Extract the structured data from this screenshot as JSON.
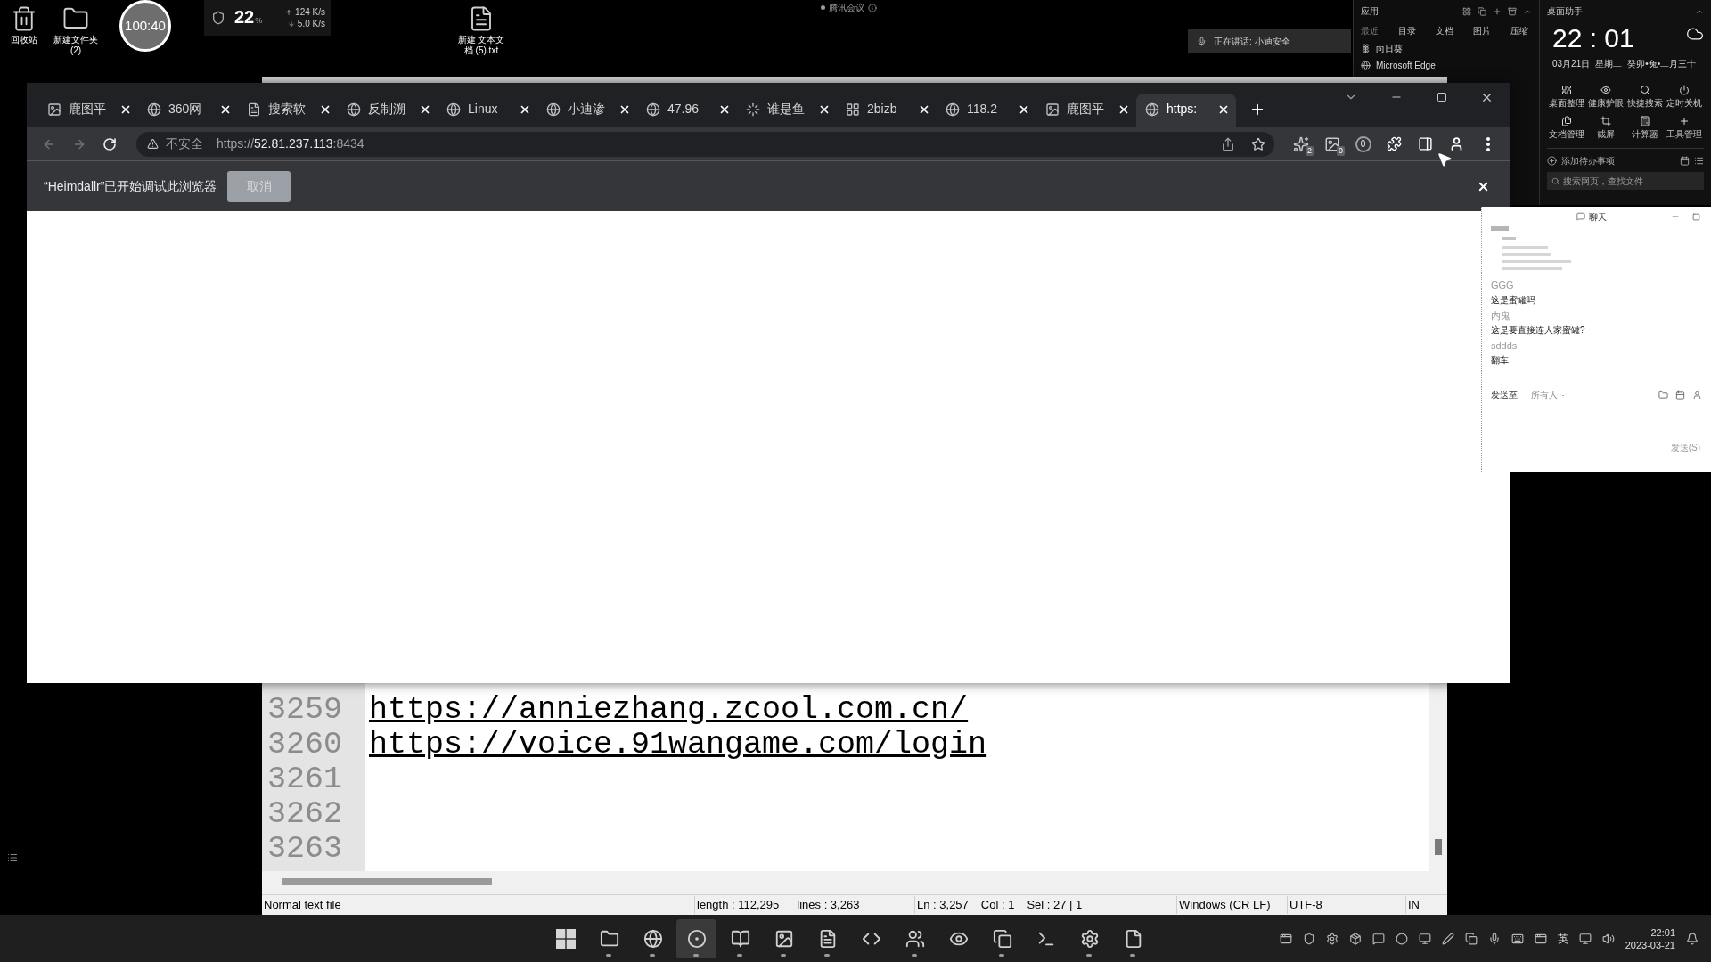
{
  "desktop_icons": [
    {
      "kind": "bin",
      "label": "回收站"
    },
    {
      "kind": "folder",
      "label": "新建文件夹 (2)"
    },
    {
      "kind": "text_file",
      "label": "新建 文本文档 (5).txt"
    }
  ],
  "timer_widget": {
    "text": "100:40"
  },
  "net_monitor": {
    "cpu": "22",
    "cpu_unit": "%",
    "upload": "124 K/s",
    "download": "5.0 K/s"
  },
  "meeting_indicator": {
    "label": "腾讯会议"
  },
  "speaking_bar": {
    "text": "正在讲话: 小迪安全"
  },
  "apps_panel": {
    "title": "应用",
    "tabs": [
      {
        "label": "最近",
        "selected": true
      },
      {
        "label": "目录",
        "selected": false
      },
      {
        "label": "文档",
        "selected": false
      },
      {
        "label": "图片",
        "selected": false
      },
      {
        "label": "压缩",
        "selected": false
      }
    ],
    "items": [
      {
        "kind": "sunflower",
        "label": "向日葵"
      },
      {
        "kind": "edge",
        "label": "Microsoft Edge"
      }
    ]
  },
  "desk_assistant": {
    "title": "桌面助手",
    "time": "22 : 01",
    "date": "03月21日",
    "weekday": "星期二",
    "lunar": "癸卯•兔•二月三十",
    "tools": [
      {
        "kind": "organize",
        "label": "桌面整理"
      },
      {
        "kind": "eye",
        "label": "健康护眼"
      },
      {
        "kind": "search",
        "label": "快捷搜索"
      },
      {
        "kind": "power",
        "label": "定时关机"
      },
      {
        "kind": "docs",
        "label": "文档管理"
      },
      {
        "kind": "crop",
        "label": "截屏"
      },
      {
        "kind": "calculator",
        "label": "计算器"
      },
      {
        "kind": "plus",
        "label": "工具管理"
      }
    ],
    "todo": "添加待办事项",
    "search": {
      "placeholder": "搜索网页，查找文件"
    }
  },
  "browser": {
    "tabs": [
      {
        "title": "鹿图平",
        "kind": "image",
        "selected": false
      },
      {
        "title": "360网",
        "kind": "globe",
        "selected": false
      },
      {
        "title": "搜索软",
        "kind": "doc",
        "selected": false
      },
      {
        "title": "反制溯",
        "kind": "globe",
        "selected": false
      },
      {
        "title": "Linux",
        "kind": "globe",
        "selected": false
      },
      {
        "title": "小迪渗",
        "kind": "globe",
        "selected": false
      },
      {
        "title": "47.96",
        "kind": "globe",
        "selected": false
      },
      {
        "title": "谁是鱼",
        "kind": "loader",
        "selected": false
      },
      {
        "title": "2bizb",
        "kind": "grid",
        "selected": false
      },
      {
        "title": "118.2",
        "kind": "globe",
        "selected": false
      },
      {
        "title": "鹿图平",
        "kind": "image",
        "selected": false
      },
      {
        "title": "https:",
        "kind": "globe",
        "selected": true
      }
    ],
    "address": {
      "security": "不安全",
      "scheme": "https://",
      "host": "52.81.237.113",
      "port": ":8434"
    },
    "extensions": [
      {
        "kind": "sparkle",
        "badge": "2"
      },
      {
        "kind": "image",
        "badge": "0"
      },
      {
        "kind": "ring",
        "badge": "0"
      }
    ],
    "infobar": {
      "message": "“Heimdallr”已开始调试此浏览器",
      "button": "取消"
    }
  },
  "notepad": {
    "lines": [
      {
        "number": "3259",
        "text": "https://anniezhang.zcool.com.cn/"
      },
      {
        "number": "3260",
        "text": "https://voice.91wangame.com/login"
      },
      {
        "number": "3261"
      },
      {
        "number": "3262"
      },
      {
        "number": "3263"
      }
    ],
    "status": {
      "file_type": "Normal text file",
      "length": "length : 112,295",
      "lines": "lines : 3,263",
      "position": "Ln : 3,257",
      "column": "Col : 1",
      "selection": "Sel : 27 | 1",
      "eol": "Windows (CR LF)",
      "encoding": "UTF-8",
      "mode": "IN"
    }
  },
  "chat": {
    "title": "聊天",
    "messages": [
      {
        "sender": "GGG",
        "text": "这是蜜罐吗"
      },
      {
        "sender": "内鬼",
        "text": "这是要直接连人家蜜罐?"
      },
      {
        "sender": "sddds",
        "text": "翻车"
      }
    ],
    "send_to_label": "发送至:",
    "recipient": "所有人",
    "send_button": "发送(S)"
  },
  "taskbar": {
    "apps": [
      {
        "kind": "start",
        "selected": false,
        "running": false
      },
      {
        "kind": "folder",
        "selected": false,
        "running": true
      },
      {
        "kind": "globe",
        "selected": false,
        "running": true
      },
      {
        "kind": "browser",
        "selected": true,
        "running": true
      },
      {
        "kind": "book",
        "selected": false,
        "running": true
      },
      {
        "kind": "image",
        "selected": false,
        "running": true
      },
      {
        "kind": "document",
        "selected": false,
        "running": true
      },
      {
        "kind": "code",
        "selected": false,
        "running": false
      },
      {
        "kind": "people",
        "selected": false,
        "running": true
      },
      {
        "kind": "eye",
        "selected": false,
        "running": false
      },
      {
        "kind": "copy",
        "selected": false,
        "running": true
      },
      {
        "kind": "terminal",
        "selected": false,
        "running": false
      },
      {
        "kind": "gear",
        "selected": false,
        "running": true
      },
      {
        "kind": "file",
        "selected": false,
        "running": true
      }
    ],
    "tray_left": [
      {
        "kind": "window"
      },
      {
        "kind": "shield"
      },
      {
        "kind": "gear"
      },
      {
        "kind": "box"
      },
      {
        "kind": "message"
      },
      {
        "kind": "dot"
      },
      {
        "kind": "monitor"
      },
      {
        "kind": "pen"
      },
      {
        "kind": "copy"
      },
      {
        "kind": "mic"
      },
      {
        "kind": "keyboard"
      },
      {
        "kind": "window"
      }
    ],
    "ime": "英",
    "tray_right": [
      {
        "kind": "monitor"
      },
      {
        "kind": "volume"
      }
    ],
    "time": "22:01",
    "date": "2023-03-21"
  }
}
